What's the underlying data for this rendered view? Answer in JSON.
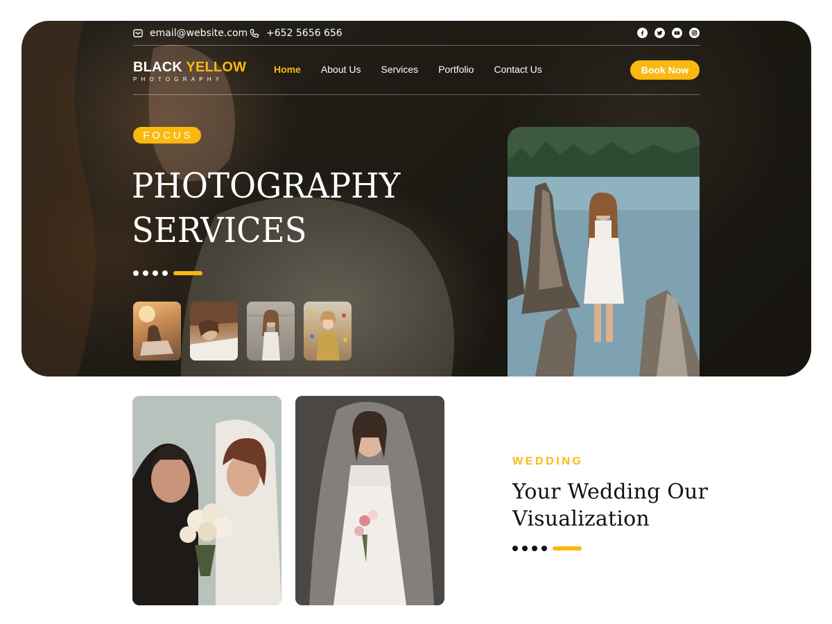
{
  "topbar": {
    "email": "email@website.com",
    "phone": "+652 5656 656",
    "socials": [
      "facebook-icon",
      "twitter-icon",
      "youtube-icon",
      "instagram-icon"
    ]
  },
  "logo": {
    "word1": "BLACK",
    "word2": "YELLOW",
    "tagline": "PHOTOGRAPHY"
  },
  "nav": {
    "items": [
      {
        "label": "Home",
        "active": true
      },
      {
        "label": "About Us",
        "active": false
      },
      {
        "label": "Services",
        "active": false
      },
      {
        "label": "Portfolio",
        "active": false
      },
      {
        "label": "Contact Us",
        "active": false
      }
    ],
    "cta": "Book Now"
  },
  "hero": {
    "badge": "FOCUS",
    "title_line1": "PHOTOGRAPHY",
    "title_line2": "SERVICES",
    "slider_dots": 4,
    "thumbnails": [
      "sunset-portrait",
      "lying-portrait",
      "steps-portrait",
      "child-christmas-portrait"
    ],
    "main_photo": "woman-in-lake"
  },
  "wedding": {
    "label": "WEDDING",
    "title_line1": "Your Wedding Our",
    "title_line2": "Visualization",
    "photos": [
      "couple-with-bouquet",
      "bride-with-veil"
    ]
  },
  "colors": {
    "accent": "#fbb90f",
    "dark": "#111111",
    "white": "#ffffff"
  }
}
